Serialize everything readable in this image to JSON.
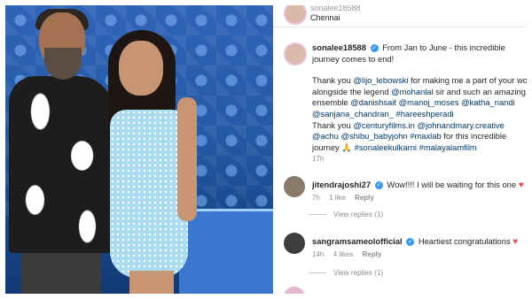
{
  "post": {
    "top_username": "sonalee18588",
    "location": "Chennai",
    "author": "sonalee18588",
    "caption_line1": "From Jan to June - this incredible journey comes to end!",
    "caption_p2_prefix": "Thank you ",
    "caption_p2_mention1": "@lijo_lebowski",
    "caption_p2_mid1": " for making me a part of your wo alongside the legend ",
    "caption_p2_mention2": "@mohanlal",
    "caption_p2_mid2": " sir and such an amazing ensemble ",
    "caption_p2_mention3": "@danishsait @manoj_moses @katha_nandi @sanjana_chandran_ #hareeshperadi",
    "caption_p3_prefix": "Thank you ",
    "caption_p3_mentions": "@centuryfilms.in @johnandmary.creative @achu @shibu_babyjohn #maxlab",
    "caption_p3_suffix": " for this incredible journey 🙏",
    "caption_p3_tags": "#sonaleekulkarni #malayalamfilm",
    "time": "17h"
  },
  "comments": [
    {
      "username": "jitendrajoshi27",
      "text": "Wow!!!! I will be waiting for this one",
      "emoji": "♥",
      "time": "7h",
      "likes": "1 like",
      "reply": "Reply",
      "view_replies": "View replies (1)"
    },
    {
      "username": "sangramsameolofficial",
      "text": "Heartiest congratulations",
      "emoji": "♥",
      "time": "14h",
      "likes": "4 likes",
      "reply": "Reply",
      "view_replies": "View replies (1)"
    }
  ],
  "colors": {
    "verified": "#3897f0",
    "link": "#00376b",
    "heart": "#ed4956"
  }
}
